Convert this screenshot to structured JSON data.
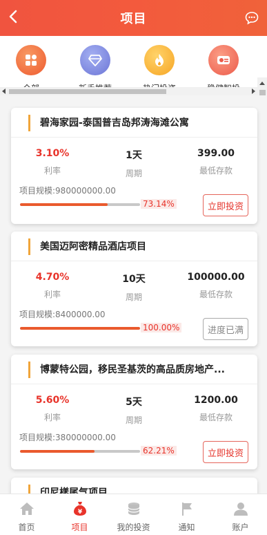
{
  "header": {
    "title": "项目"
  },
  "categories": [
    {
      "label": "全部",
      "color": "#f16a3a",
      "icon": "grid-icon"
    },
    {
      "label": "新手推荐",
      "color": "#7b86de",
      "icon": "diamond-icon"
    },
    {
      "label": "热门投资",
      "color": "#f7b22b",
      "icon": "flame-icon"
    },
    {
      "label": "稳健智投",
      "color": "#f06a58",
      "icon": "money-icon"
    }
  ],
  "projects": [
    {
      "name": "碧海家园-泰国普吉岛邦涛海滩公寓",
      "rate": "3.10%",
      "rate_label": "利率",
      "period": "1天",
      "period_label": "周期",
      "min_deposit": "399.00",
      "min_label": "最低存款",
      "scale": "项目规模:980000000.00",
      "progress_text": "73.14%",
      "progress": 73.14,
      "button": "立即投资",
      "full": false
    },
    {
      "name": "美国迈阿密精品酒店项目",
      "rate": "4.70%",
      "rate_label": "利率",
      "period": "10天",
      "period_label": "周期",
      "min_deposit": "100000.00",
      "min_label": "最低存款",
      "scale": "项目规模:8400000.00",
      "progress_text": "100.00%",
      "progress": 100,
      "button": "进度已满",
      "full": true
    },
    {
      "name": "博蒙特公园，移民圣基茨的高品质房地产...",
      "rate": "5.60%",
      "rate_label": "利率",
      "period": "5天",
      "period_label": "周期",
      "min_deposit": "1200.00",
      "min_label": "最低存款",
      "scale": "项目规模:380000000.00",
      "progress_text": "62.21%",
      "progress": 62.21,
      "button": "立即投资",
      "full": false
    },
    {
      "name": "印尼樣尾气项目"
    }
  ],
  "tabs": [
    {
      "label": "首页",
      "icon": "home-icon",
      "active": false
    },
    {
      "label": "项目",
      "icon": "money-bag-icon",
      "active": true
    },
    {
      "label": "我的投资",
      "icon": "coins-icon",
      "active": false
    },
    {
      "label": "通知",
      "icon": "flag-icon",
      "active": false
    },
    {
      "label": "账户",
      "icon": "user-icon",
      "active": false
    }
  ]
}
